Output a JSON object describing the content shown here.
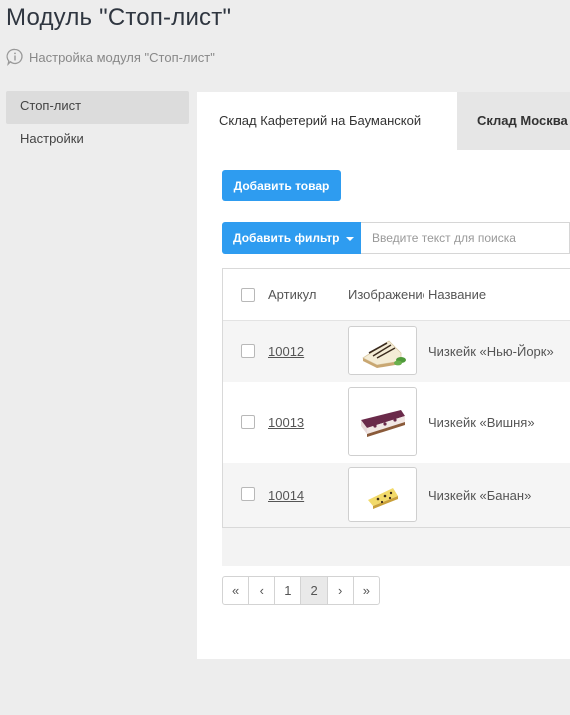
{
  "header": {
    "title": "Модуль \"Стоп-лист\"",
    "subtitle": "Настройка модуля \"Стоп-лист\""
  },
  "sidebar": {
    "items": [
      {
        "label": "Стоп-лист",
        "active": true
      },
      {
        "label": "Настройки",
        "active": false
      }
    ]
  },
  "tabs": [
    {
      "label": "Склад Кафетерий на Бауманской",
      "active": true
    },
    {
      "label": "Склад Москва",
      "active": false
    }
  ],
  "toolbar": {
    "add_item_label": "Добавить товар",
    "add_filter_label": "Добавить фильтр",
    "search_placeholder": "Введите текст для поиска"
  },
  "table": {
    "columns": {
      "article": "Артикул",
      "image": "Изображение",
      "name": "Название"
    },
    "rows": [
      {
        "article": "10012",
        "name": "Чизкейк «Нью-Йорк»",
        "image": "cheesecake-new-york"
      },
      {
        "article": "10013",
        "name": "Чизкейк «Вишня»",
        "image": "cheesecake-cherry"
      },
      {
        "article": "10014",
        "name": "Чизкейк «Банан»",
        "image": "cheesecake-banana"
      }
    ]
  },
  "pagination": {
    "first": "«",
    "prev": "‹",
    "pages": [
      "1",
      "2"
    ],
    "current": "2",
    "next": "›",
    "last": "»"
  },
  "colors": {
    "primary": "#2e9cf0",
    "background": "#ededed",
    "panel": "#ffffff"
  }
}
